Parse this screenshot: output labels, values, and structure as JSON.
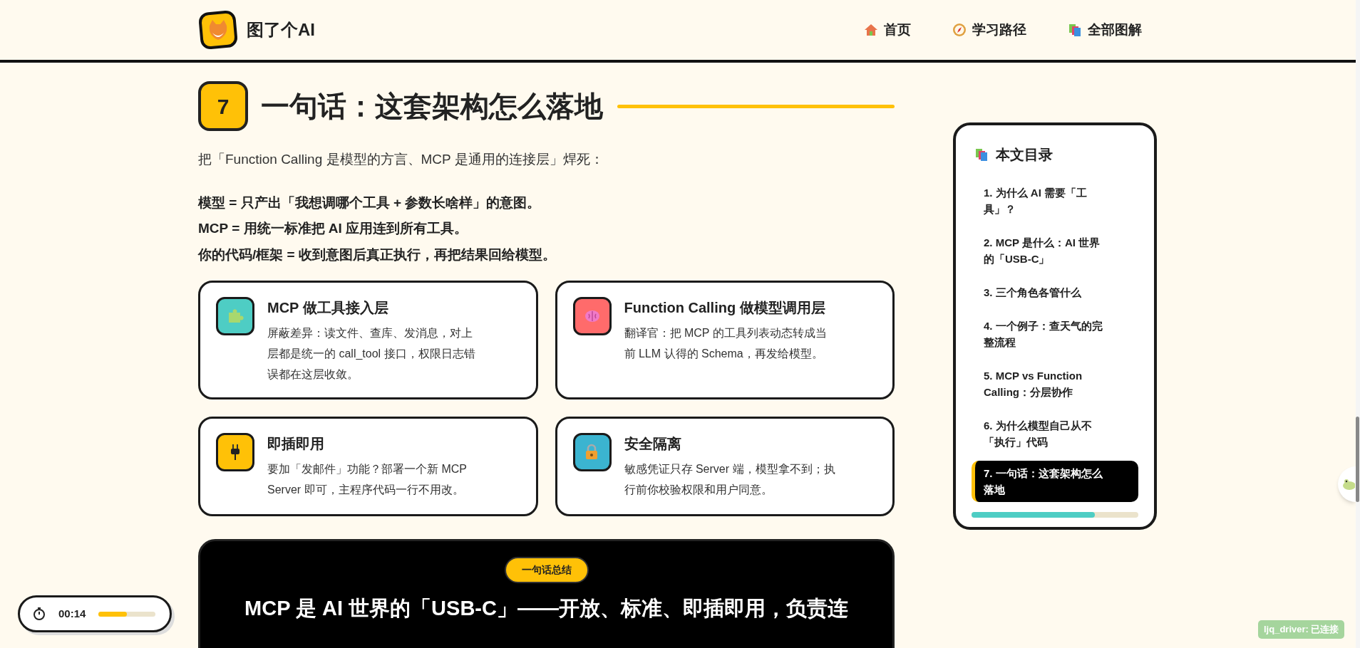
{
  "header": {
    "brand": "图了个AI",
    "nav": [
      {
        "label": "首页"
      },
      {
        "label": "学习路径"
      },
      {
        "label": "全部图解"
      }
    ]
  },
  "section": {
    "number": "7",
    "title": "一句话：这套架构怎么落地",
    "intro": "把「Function Calling 是模型的方言、MCP 是通用的连接层」焊死：",
    "points": [
      "模型 = 只产出「我想调哪个工具 + 参数长啥样」的意图。",
      "MCP = 用统一标准把 AI 应用连到所有工具。",
      "你的代码/框架 = 收到意图后真正执行，再把结果回给模型。"
    ]
  },
  "cards": [
    {
      "color": "#4ecdc4",
      "title": "MCP 做工具接入层",
      "text": "屏蔽差异：读文件、查库、发消息，对上层都是统一的 call_tool 接口，权限日志错误都在这层收敛。"
    },
    {
      "color": "#ff6b6b",
      "title": "Function Calling 做模型调用层",
      "text": "翻译官：把 MCP 的工具列表动态转成当前 LLM 认得的 Schema，再发给模型。"
    },
    {
      "color": "#ffc107",
      "title": "即插即用",
      "text": "要加「发邮件」功能？部署一个新 MCP Server 即可，主程序代码一行不用改。"
    },
    {
      "color": "#3bb4d0",
      "title": "安全隔离",
      "text": "敏感凭证只存 Server 端，模型拿不到；执行前你校验权限和用户同意。"
    }
  ],
  "summary": {
    "badge": "一句话总结",
    "text": "MCP 是 AI 世界的「USB-C」——开放、标准、即插即用，负责连"
  },
  "toc": {
    "title": "本文目录",
    "items": [
      {
        "label": "1. 为什么 AI 需要「工具」？",
        "selected": false
      },
      {
        "label": "2. MCP 是什么：AI 世界的「USB-C」",
        "selected": false
      },
      {
        "label": "3. 三个角色各管什么",
        "selected": false
      },
      {
        "label": "4. 一个例子：查天气的完整流程",
        "selected": false
      },
      {
        "label": "5. MCP vs Function Calling：分层协作",
        "selected": false
      },
      {
        "label": "6. 为什么模型自己从不「执行」代码",
        "selected": false
      },
      {
        "label": "7. 一句话：这套架构怎么落地",
        "selected": true
      }
    ],
    "progress": {
      "level": 0.74
    }
  },
  "timer": {
    "time": "00:14",
    "level": 0.5
  },
  "status": {
    "text": "ljq_driver: 已连接"
  }
}
